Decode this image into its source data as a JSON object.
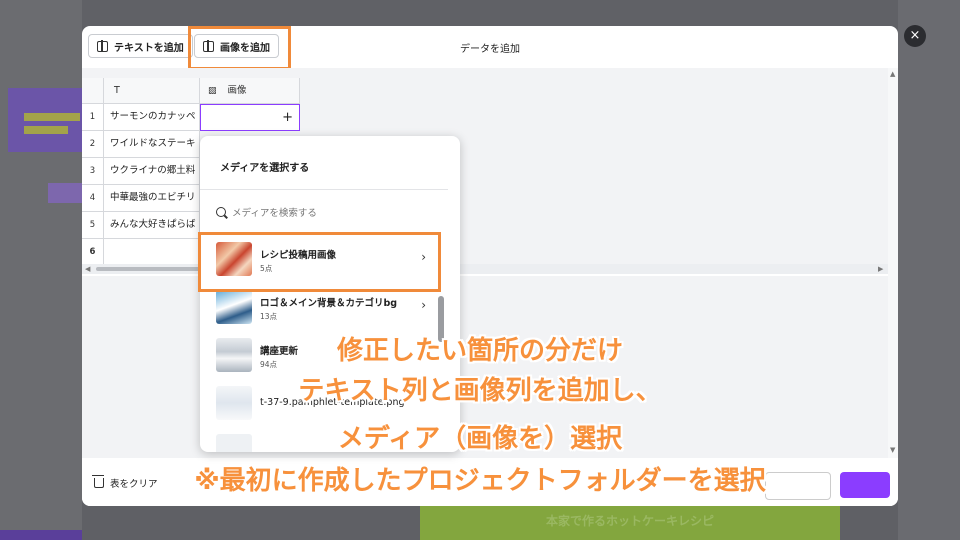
{
  "modal": {
    "title": "データを追加",
    "add_text_label": "テキストを追加",
    "add_image_label": "画像を追加",
    "clear_label": "表をクリア",
    "close_glyph": "×"
  },
  "table": {
    "headers": [
      {
        "icon": "text-icon",
        "glyph": "T",
        "label": ""
      },
      {
        "icon": "image-icon",
        "glyph": "▧",
        "label": "画像"
      }
    ],
    "rows": [
      {
        "num": "1",
        "text": "サーモンのカナッペ"
      },
      {
        "num": "2",
        "text": "ワイルドなステーキ"
      },
      {
        "num": "3",
        "text": "ウクライナの郷土料"
      },
      {
        "num": "4",
        "text": "中華最強のエビチリ"
      },
      {
        "num": "5",
        "text": "みんな大好きぱらば"
      },
      {
        "num": "6",
        "text": ""
      }
    ],
    "add_glyph": "+"
  },
  "media_panel": {
    "title": "メディアを選択する",
    "search_placeholder": "メディアを検索する",
    "folders": [
      {
        "name": "レシピ投稿用画像",
        "count": "5点",
        "chevron": "›"
      },
      {
        "name": "ロゴ＆メイン背景＆カテゴリbg",
        "count": "13点",
        "chevron": "›"
      },
      {
        "name": "講座更新",
        "count": "94点",
        "chevron": ""
      },
      {
        "name": "t-37-9.pamphlet-template.png",
        "count": "",
        "chevron": ""
      }
    ]
  },
  "background": {
    "bottom_button": "本家で作るホットケーキレシピ"
  },
  "caption": {
    "line1": "修正したい箇所の分だけ",
    "line2": "テキスト列と画像列を追加し、",
    "line3": "メディア（画像を）選択",
    "line4": "※最初に作成したプロジェクトフォルダーを選択"
  },
  "colors": {
    "accent": "#8b3dff",
    "highlight": "#f08a3a",
    "caption": "#f7913c"
  }
}
